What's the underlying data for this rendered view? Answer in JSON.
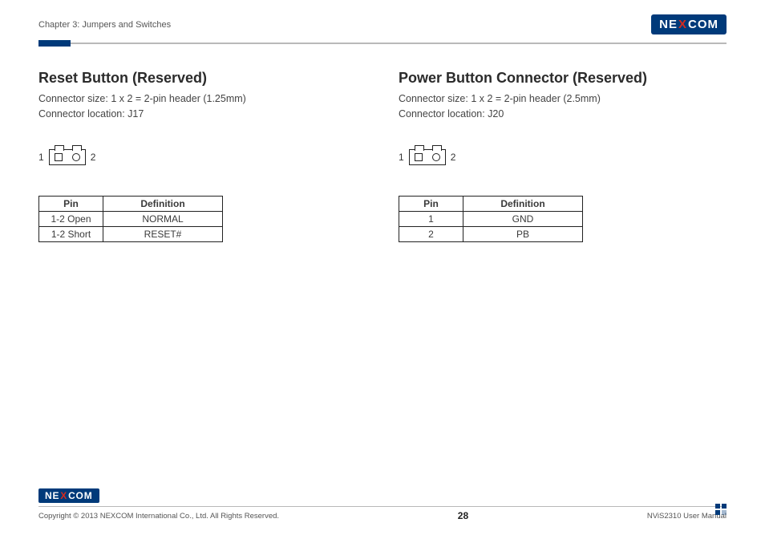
{
  "header": {
    "chapter": "Chapter 3: Jumpers and Switches",
    "brand_left": "NE",
    "brand_x": "X",
    "brand_right": "COM"
  },
  "sections": {
    "left": {
      "title": "Reset Button (Reserved)",
      "line1": "Connector size: 1 x 2 = 2-pin header (1.25mm)",
      "line2": "Connector location: J17",
      "pin_left": "1",
      "pin_right": "2",
      "table": {
        "h1": "Pin",
        "h2": "Definition",
        "rows": [
          {
            "pin": "1-2 Open",
            "def": "NORMAL"
          },
          {
            "pin": "1-2 Short",
            "def": "RESET#"
          }
        ]
      }
    },
    "right": {
      "title": "Power Button Connector (Reserved)",
      "line1": "Connector size: 1 x 2 = 2-pin header (2.5mm)",
      "line2": "Connector location: J20",
      "pin_left": "1",
      "pin_right": "2",
      "table": {
        "h1": "Pin",
        "h2": "Definition",
        "rows": [
          {
            "pin": "1",
            "def": "GND"
          },
          {
            "pin": "2",
            "def": "PB"
          }
        ]
      }
    }
  },
  "footer": {
    "copyright": "Copyright © 2013 NEXCOM International Co., Ltd. All Rights Reserved.",
    "page": "28",
    "doc": "NViS2310 User Manual"
  }
}
